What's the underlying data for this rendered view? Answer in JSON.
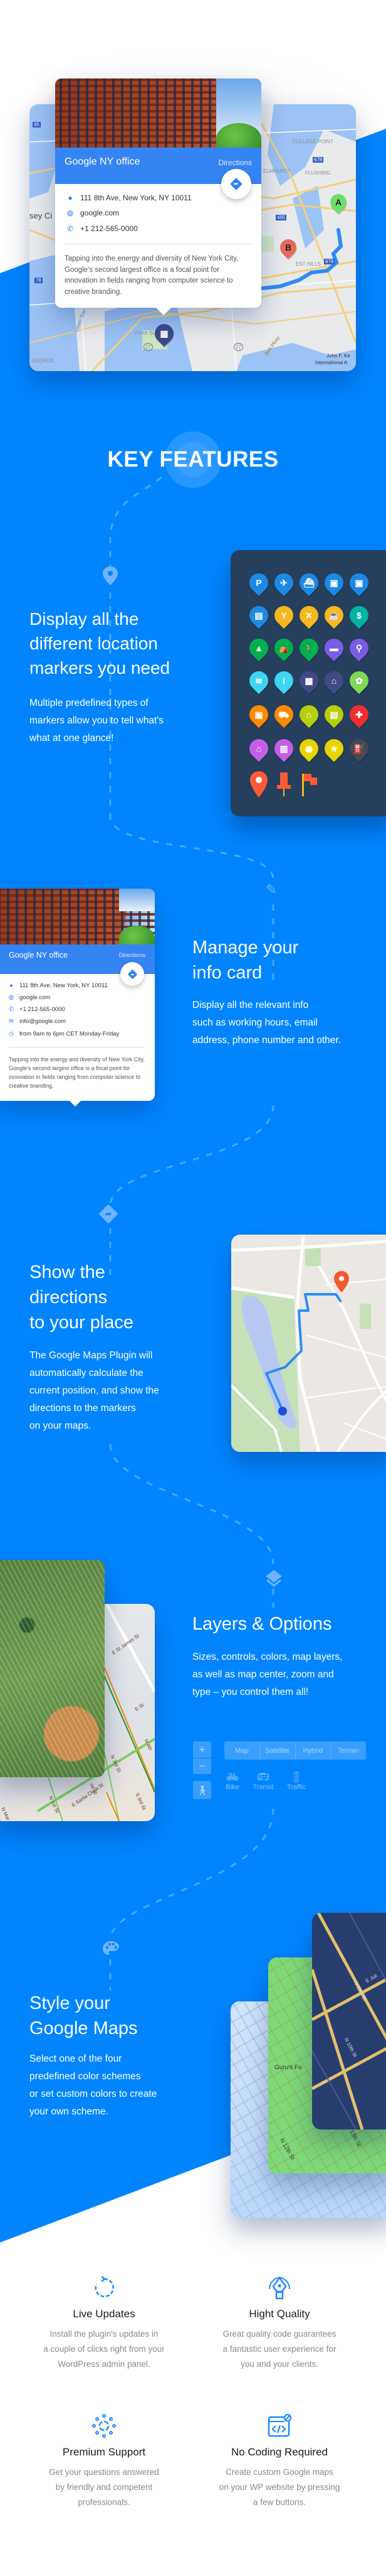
{
  "colors": {
    "brand_blue": "#0085ff",
    "card_header": "#3584f4",
    "marker_panel": "#253f5c",
    "feature_icon": "#1e88ff"
  },
  "hero": {
    "info_card": {
      "title": "Google NY office",
      "directions_label": "Directions",
      "address": "111 8th Ave, New York, NY 10011",
      "website": "google.com",
      "phone": "+1 212-565-0000",
      "description": "Tapping into the energy and diversity of New York City, Google's second largest office is a focal point for innovation in fields ranging from computer science to creative branding."
    },
    "map": {
      "labels": [
        "COLLEGE POINT",
        "FLUSHING",
        "ELMHURST",
        "EST HILLS",
        "PARK SLOPE",
        "Upper Bay",
        "GEORGE",
        "Belt Pkwy",
        "John F. Ke",
        "International A",
        "sey Ci"
      ],
      "shields": [
        "95",
        "678",
        "495",
        "678",
        "78",
        "27",
        "27"
      ],
      "marker_a": "A",
      "marker_b": "B",
      "marker_icon": "building-icon"
    }
  },
  "key_features_title": "KEY FEATURES",
  "sections": {
    "markers": {
      "title_lines": [
        "Display all the",
        "different location",
        "markers you need"
      ],
      "text_lines": [
        "Multiple predefined types of",
        "markers allow you to tell what's",
        "what at one glance!"
      ],
      "step_icon": "map-pin-icon",
      "markers": [
        {
          "icon": "parking",
          "color": "#1e88e5"
        },
        {
          "icon": "airport",
          "color": "#1e88e5"
        },
        {
          "icon": "ferry",
          "color": "#1e88e5"
        },
        {
          "icon": "train",
          "color": "#1e88e5"
        },
        {
          "icon": "subway",
          "color": "#1e88e5"
        },
        {
          "icon": "bus",
          "color": "#1e88e5"
        },
        {
          "icon": "bar",
          "color": "#f4b91e"
        },
        {
          "icon": "restaurant",
          "color": "#f4b91e"
        },
        {
          "icon": "cafe",
          "color": "#f4b91e"
        },
        {
          "icon": "atm",
          "color": "#00b3a4"
        },
        {
          "icon": "mountain",
          "color": "#00b050"
        },
        {
          "icon": "camping",
          "color": "#00b050"
        },
        {
          "icon": "hiking",
          "color": "#00b050"
        },
        {
          "icon": "hotel",
          "color": "#7b5ce6"
        },
        {
          "icon": "restroom",
          "color": "#7b5ce6"
        },
        {
          "icon": "wifi",
          "color": "#3dd5f3"
        },
        {
          "icon": "info",
          "color": "#3dd5f3"
        },
        {
          "icon": "office",
          "color": "#414a86"
        },
        {
          "icon": "home",
          "color": "#414a86"
        },
        {
          "icon": "pets",
          "color": "#7ed957"
        },
        {
          "icon": "shopping",
          "color": "#ff8a00"
        },
        {
          "icon": "cart",
          "color": "#ff8a00"
        },
        {
          "icon": "school",
          "color": "#b5cf0a"
        },
        {
          "icon": "library",
          "color": "#b5cf0a"
        },
        {
          "icon": "hospital",
          "color": "#f22d2d"
        },
        {
          "icon": "museum",
          "color": "#c45ee6"
        },
        {
          "icon": "movie",
          "color": "#c45ee6"
        },
        {
          "icon": "camera",
          "color": "#e8d500"
        },
        {
          "icon": "star",
          "color": "#e8d500"
        },
        {
          "icon": "gas",
          "color": "#454a55"
        }
      ],
      "extra_markers": [
        {
          "icon": "pin",
          "color": "#ff5a36"
        },
        {
          "icon": "pushpin",
          "color": "#ff5a36"
        },
        {
          "icon": "flag",
          "color": "#ff5a36"
        }
      ]
    },
    "info_card": {
      "title_lines": [
        "Manage your",
        "info card"
      ],
      "text_lines": [
        "Display all the relevant info",
        "such as working hours, email",
        "address, phone number and other."
      ],
      "step_icon": "pen-icon",
      "card": {
        "title": "Google NY office",
        "directions_label": "Directions",
        "address": "111 8th Ave, New York, NY 10011",
        "website": "google.com",
        "phone": "+1 212-565-0000",
        "email": "info@google.com",
        "hours": "from 9am to 6pm CET Monday-Friday",
        "description": "Tapping into the energy and diversity of New York City, Google's second largest office is a focal point for innovation in fields ranging from computer science to creative branding."
      }
    },
    "directions": {
      "title_lines": [
        "Show the",
        "directions",
        "to your place"
      ],
      "text_lines": [
        "The Google Maps Plugin will",
        "automatically calculate the",
        "current position, and show the",
        "directions to the markers",
        "on your maps."
      ],
      "step_icon": "directions-icon"
    },
    "layers": {
      "title": "Layers & Options",
      "text_lines": [
        "Sizes, controls, colors, map layers,",
        "as well as map center, zoom and",
        "type – you control them all!"
      ],
      "step_icon": "layers-icon",
      "zoom_in": "+",
      "zoom_out": "−",
      "map_types": [
        "Map",
        "Satellite",
        "Hybrid",
        "Terrain"
      ],
      "layer_options": [
        {
          "label": "Bike",
          "icon": "bike-icon"
        },
        {
          "label": "Transit",
          "icon": "bus-icon"
        },
        {
          "label": "Traffic",
          "icon": "traffic-light-icon"
        }
      ],
      "street_labels": [
        "E St James St",
        "E St",
        "N 4th",
        "N 3rd St",
        "N 1st St",
        "nd St",
        "E Santa Clara St",
        "S 3rd St",
        "N Mar"
      ]
    },
    "style": {
      "title_lines": [
        "Style your",
        "Google Maps"
      ],
      "text_lines": [
        "Select one of the four",
        "predefined color schemes",
        "or set custom colors to create",
        "your own scheme."
      ],
      "step_icon": "palette-icon",
      "map_labels": [
        "Guru's Fo",
        "N 12th St",
        "N 10th St",
        "N 10th St",
        "E Juli",
        "13th St"
      ]
    }
  },
  "features": [
    {
      "title": "Live Updates",
      "icon": "refresh-icon",
      "text_lines": [
        "Install the plugin's updates in",
        "a couple of clicks right from your",
        "WordPress admin panel."
      ]
    },
    {
      "title": "Hight Quality",
      "icon": "pen-tool-icon",
      "text_lines": [
        "Great quality code guarantees",
        "a fantastic user experience for",
        "you and your clients."
      ]
    },
    {
      "title": "Premium Support",
      "icon": "support-icon",
      "text_lines": [
        "Get your questions answered",
        "by friendly and competent",
        "professionals."
      ]
    },
    {
      "title": "No Coding Required",
      "icon": "code-icon",
      "text_lines": [
        "Create custom Google maps",
        "on your WP website by pressing",
        "a few buttons."
      ]
    }
  ]
}
